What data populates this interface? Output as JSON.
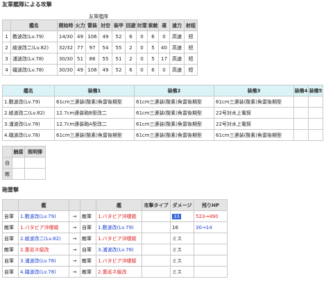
{
  "section1_title": "友軍艦隊による攻撃",
  "fleet_label": "友軍艦隊",
  "fleet_headers": [
    "",
    "艦名",
    "開始時",
    "火力",
    "雷装",
    "対空",
    "装甲",
    "回避",
    "対潜",
    "索敵",
    "運",
    "速力",
    "射程"
  ],
  "fleet_rows": [
    [
      "1",
      "敷波改(Lv.79)",
      "14/30",
      "49",
      "106",
      "49",
      "52",
      "6",
      "0",
      "6",
      "0",
      "高速",
      "短"
    ],
    [
      "2",
      "綾波改二(Lv.82)",
      "32/32",
      "77",
      "97",
      "54",
      "55",
      "2",
      "0",
      "5",
      "40",
      "高速",
      "短"
    ],
    [
      "3",
      "浦波改(Lv.78)",
      "30/30",
      "51",
      "88",
      "55",
      "51",
      "2",
      "0",
      "5",
      "17",
      "高速",
      "短"
    ],
    [
      "4",
      "磯波改(Lv.78)",
      "30/30",
      "49",
      "106",
      "49",
      "52",
      "6",
      "0",
      "6",
      "0",
      "高速",
      "短"
    ]
  ],
  "equip_headers": [
    "艦名",
    "装備1",
    "装備2",
    "装備3",
    "装備4",
    "装備5"
  ],
  "equip_rows": [
    [
      "1.敷波改(Lv.79)",
      "61cm三連装(酸素)魚雷後期型",
      "61cm三連装(酸素)魚雷後期型",
      "61cm三連装(酸素)魚雷後期型",
      "",
      ""
    ],
    [
      "2.綾波改二(Lv.82)",
      "12.7cm連装砲B型改二",
      "61cm三連装(酸素)魚雷後期型",
      "22号対水上電探",
      "",
      ""
    ],
    [
      "3.浦波改(Lv.78)",
      "12.7cm連装砲A型改二",
      "61cm三連装(酸素)魚雷後期型",
      "22号対水上電探",
      "",
      ""
    ],
    [
      "4.磯波改(Lv.78)",
      "61cm三連装(酸素)魚雷後期型",
      "61cm三連装(酸素)魚雷後期型",
      "61cm三連装(酸素)魚雷後期型",
      "",
      ""
    ]
  ],
  "light_headers": [
    "",
    "触接",
    "照明弾"
  ],
  "light_rows": [
    [
      "自",
      "",
      ""
    ],
    [
      "敵",
      "",
      ""
    ]
  ],
  "section2_title": "砲雷撃",
  "torp_headers": [
    "",
    "艦",
    "",
    "",
    "艦",
    "攻撃タイプ",
    "ダメージ",
    "残りHP"
  ],
  "torp_rows": [
    {
      "side1": "自軍",
      "ship1": "1.敷波改(Lv.79)",
      "c1": "blue",
      "arrow": "→",
      "side2": "敵軍",
      "ship2": "1.バタビア沖棲姫",
      "c2": "red",
      "atk": "",
      "dmg": "33",
      "hp": "523→490",
      "hpc": "red",
      "hl": true
    },
    {
      "side1": "敵軍",
      "ship1": "1.バタビア沖棲姫",
      "c1": "red",
      "arrow": "→",
      "side2": "自軍",
      "ship2": "1.敷波改(Lv.79)",
      "c2": "blue",
      "atk": "",
      "dmg": "16",
      "hp": "30→14",
      "hpc": "blue",
      "hl": false
    },
    {
      "side1": "自軍",
      "ship1": "2.綾波改二(Lv.82)",
      "c1": "blue",
      "arrow": "→",
      "side2": "敵軍",
      "ship2": "1.バタビア沖棲姫",
      "c2": "red",
      "atk": "",
      "dmg": "ミス",
      "hp": "",
      "hpc": "",
      "hl": false
    },
    {
      "side1": "敵軍",
      "ship1": "2.重巡ネ級改",
      "c1": "red",
      "arrow": "→",
      "side2": "自軍",
      "ship2": "3.浦波改(Lv.78)",
      "c2": "blue",
      "atk": "",
      "dmg": "ミス",
      "hp": "",
      "hpc": "",
      "hl": false
    },
    {
      "side1": "自軍",
      "ship1": "3.浦波改(Lv.78)",
      "c1": "blue",
      "arrow": "→",
      "side2": "敵軍",
      "ship2": "1.バタビア沖棲姫",
      "c2": "red",
      "atk": "",
      "dmg": "ミス",
      "hp": "",
      "hpc": "",
      "hl": false
    },
    {
      "side1": "自軍",
      "ship1": "4.磯波改(Lv.78)",
      "c1": "blue",
      "arrow": "→",
      "side2": "敵軍",
      "ship2": "2.重巡ネ級改",
      "c2": "red",
      "atk": "",
      "dmg": "ミス",
      "hp": "",
      "hpc": "",
      "hl": false
    }
  ]
}
